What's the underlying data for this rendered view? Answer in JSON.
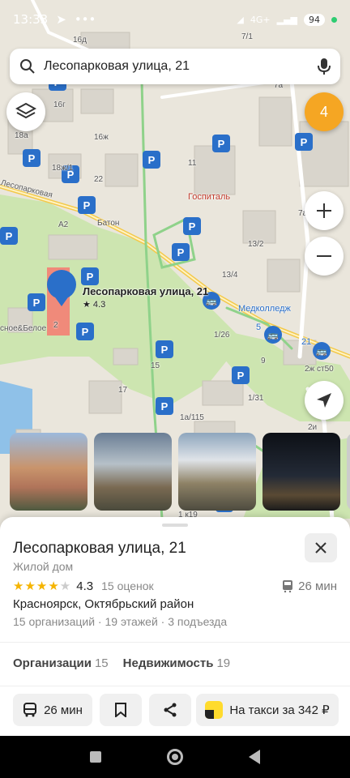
{
  "status": {
    "time": "13:33",
    "battery": "94",
    "network": "4G+"
  },
  "search": {
    "text": "Лесопарковая улица, 21"
  },
  "map": {
    "cluster_count": "4",
    "pin_label": "Лесопарковая улица, 21",
    "pin_rating": "★ 4.3",
    "labels": {
      "street": "Лесопарковая",
      "gospital": "Госпиталь",
      "baton": "Батон",
      "medcollege": "Медколледж",
      "shop": "сное&Белое",
      "b16d": "16д",
      "b7_1": "7/1",
      "b7a": "7а",
      "b16g": "16г",
      "b16zh": "16ж",
      "b18a": "18а",
      "b18zh": "18ж",
      "b18zh1": "18ж/1",
      "b22": "22",
      "b11": "11",
      "b7a2": "7а",
      "b13_2": "13/2",
      "b13_4": "13/4",
      "b1_26": "1/26",
      "b9": "9",
      "b15": "15",
      "b17": "17",
      "b1_31": "1/31",
      "b1a_115": "1а/115",
      "b2zh": "2ж ст50",
      "b2i": "2и",
      "b1k19": "1 к19",
      "a2": "А2",
      "bus5": "5",
      "bus21": "21",
      "b2": "2"
    }
  },
  "place": {
    "title": "Лесопарковая улица, 21",
    "type": "Жилой дом",
    "rating": "4.3",
    "rating_value": 4.3,
    "reviews": "15 оценок",
    "transit_time": "26 мин",
    "address": "Красноярск, Октябрьский район",
    "details": "15 организаций · 19 этажей · 3 подъезда",
    "tabs": [
      {
        "label": "Организации",
        "count": "15"
      },
      {
        "label": "Недвижимость",
        "count": "19"
      }
    ],
    "actions": {
      "route": "26 мин",
      "taxi": "На такси за 342 ₽"
    }
  },
  "colors": {
    "accent_blue": "#2a6fc9",
    "star": "#f5b400",
    "cluster": "#f5a623",
    "road": "#f3c94a",
    "park": "#cde5b0"
  }
}
